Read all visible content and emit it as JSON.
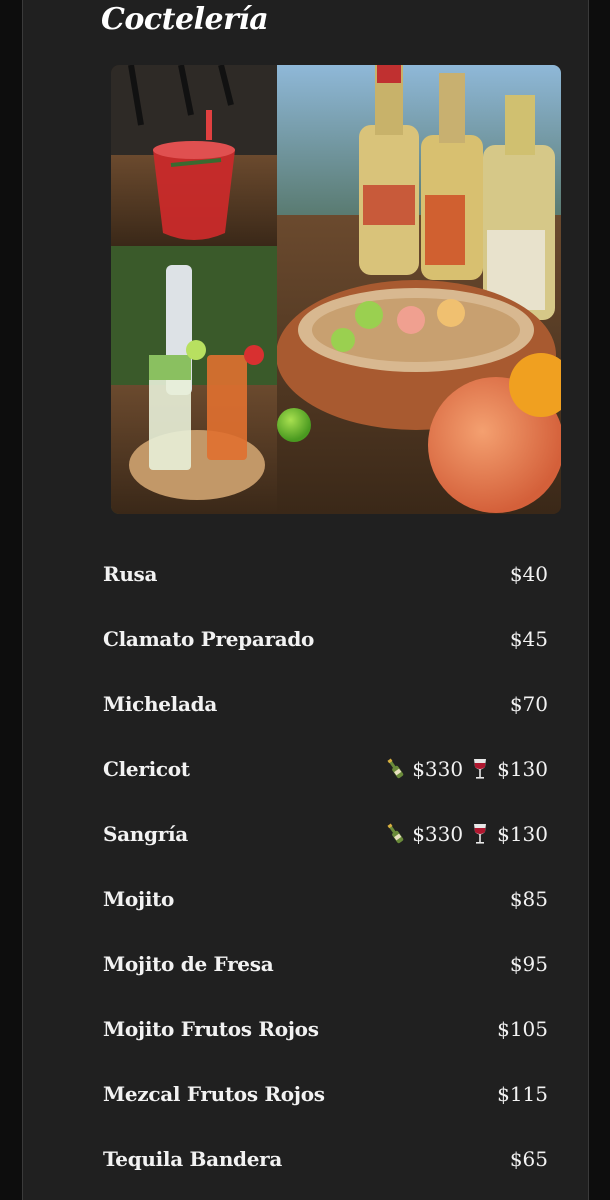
{
  "section": {
    "title": "Coctelería"
  },
  "menu": [
    {
      "name": "Rusa",
      "price": "$40"
    },
    {
      "name": "Clamato Preparado",
      "price": "$45"
    },
    {
      "name": "Michelada",
      "price": "$70"
    },
    {
      "name": "Clericot",
      "bottle_icon": "bottle-icon",
      "bottle_price": "$330",
      "glass_icon": "wine-glass-icon",
      "glass_price": "$130"
    },
    {
      "name": "Sangría",
      "bottle_icon": "bottle-icon",
      "bottle_price": "$330",
      "glass_icon": "wine-glass-icon",
      "glass_price": "$130"
    },
    {
      "name": "Mojito",
      "price": "$85"
    },
    {
      "name": "Mojito de Fresa",
      "price": "$95"
    },
    {
      "name": "Mojito Frutos Rojos",
      "price": "$105"
    },
    {
      "name": "Mezcal Frutos Rojos",
      "price": "$115"
    },
    {
      "name": "Tequila Bandera",
      "price": "$65"
    }
  ],
  "colors": {
    "background": "#0d0d0d",
    "panel": "#202020",
    "text": "#f2f2f2"
  }
}
